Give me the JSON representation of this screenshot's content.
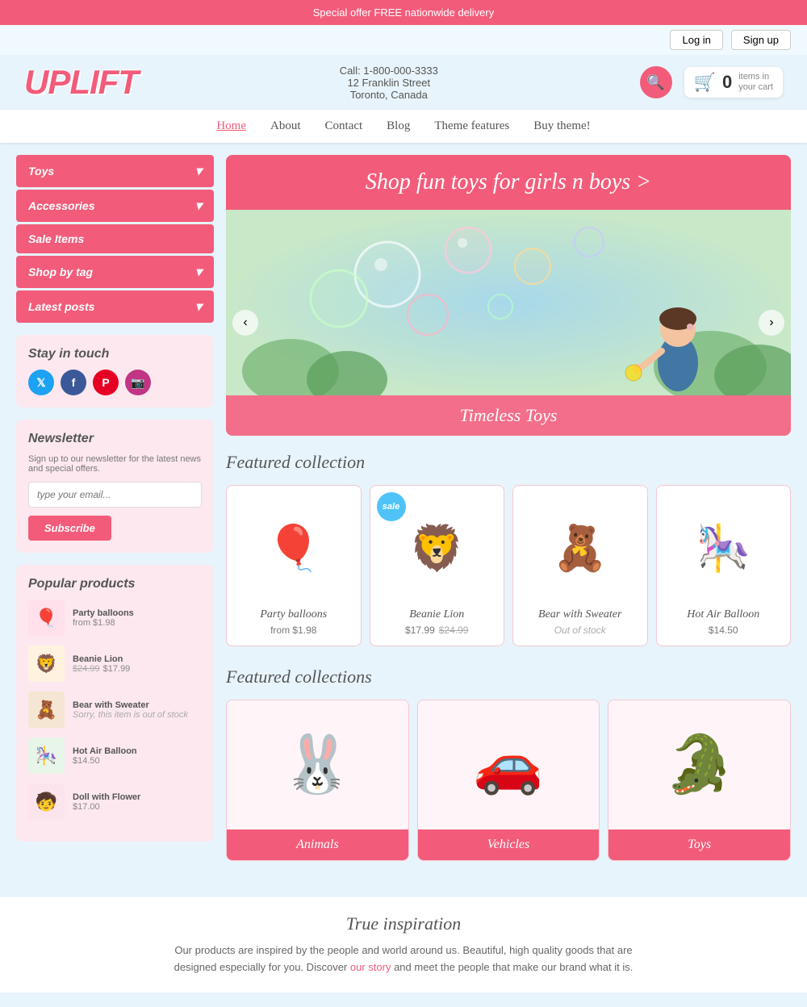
{
  "top_banner": {
    "text": "Special offer FREE nationwide delivery"
  },
  "auth": {
    "login": "Log in",
    "signup": "Sign up"
  },
  "header": {
    "logo": "UPLIFT",
    "contact_line1": "Call: 1-800-000-3333",
    "contact_line2": "12 Franklin Street",
    "contact_line3": "Toronto, Canada",
    "cart_count": "0",
    "cart_text": "items in\nyour cart"
  },
  "nav": {
    "items": [
      {
        "label": "Home",
        "active": true
      },
      {
        "label": "About"
      },
      {
        "label": "Contact"
      },
      {
        "label": "Blog"
      },
      {
        "label": "Theme features"
      },
      {
        "label": "Buy theme!"
      }
    ]
  },
  "sidebar": {
    "menu": [
      {
        "label": "Toys",
        "has_arrow": true
      },
      {
        "label": "Accessories",
        "has_arrow": true
      },
      {
        "label": "Sale Items",
        "has_arrow": false
      },
      {
        "label": "Shop by tag",
        "has_arrow": true
      },
      {
        "label": "Latest posts",
        "has_arrow": true
      }
    ],
    "stay_in_touch": {
      "title": "Stay in touch",
      "social": [
        {
          "name": "twitter",
          "symbol": "t"
        },
        {
          "name": "facebook",
          "symbol": "f"
        },
        {
          "name": "pinterest",
          "symbol": "p"
        },
        {
          "name": "instagram",
          "symbol": "i"
        }
      ]
    },
    "newsletter": {
      "title": "Newsletter",
      "description": "Sign up to our newsletter for the latest news and special offers.",
      "placeholder": "type your email...",
      "button": "Subscribe"
    },
    "popular": {
      "title": "Popular products",
      "items": [
        {
          "name": "Party balloons",
          "price": "from $1.98",
          "emoji": "🎈"
        },
        {
          "name": "Beanie Lion",
          "old_price": "$24.99",
          "price": "$17.99",
          "emoji": "🦁"
        },
        {
          "name": "Bear with Sweater",
          "status": "Sorry, this item is out of stock",
          "emoji": "🧸"
        },
        {
          "name": "Hot Air Balloon",
          "price": "$14.50",
          "emoji": "🎠"
        },
        {
          "name": "Doll with Flower",
          "price": "$17.00",
          "emoji": "🧒"
        }
      ]
    }
  },
  "hero": {
    "banner_text": "Shop fun toys for girls n boys >",
    "slider_caption": "Timeless Toys",
    "slider_prev": "‹",
    "slider_next": "›"
  },
  "featured_collection": {
    "title": "Featured collection",
    "products": [
      {
        "name": "Party balloons",
        "price": "from $1.98",
        "old_price": null,
        "status": null,
        "emoji": "🎈",
        "sale": false
      },
      {
        "name": "Beanie Lion",
        "price": "$17.99",
        "old_price": "$24.99",
        "status": null,
        "emoji": "🦁",
        "sale": true
      },
      {
        "name": "Bear with Sweater",
        "price": null,
        "old_price": null,
        "status": "Out of stock",
        "emoji": "🧸",
        "sale": false
      },
      {
        "name": "Hot Air Balloon",
        "price": "$14.50",
        "old_price": null,
        "status": null,
        "emoji": "🎠",
        "sale": false
      }
    ],
    "sale_badge": "sale"
  },
  "featured_collections": {
    "title": "Featured collections",
    "items": [
      {
        "label": "Animals",
        "emoji": "🐰"
      },
      {
        "label": "Vehicles",
        "emoji": "🚗"
      },
      {
        "label": "Toys",
        "emoji": "🐊"
      }
    ]
  },
  "inspiration": {
    "title": "True inspiration",
    "text": "Our products are inspired by the people and world around us. Beautiful, high quality goods that are designed especially for you. Discover ",
    "link_text": "our story",
    "text_after": " and meet the people that make our brand what it is."
  }
}
